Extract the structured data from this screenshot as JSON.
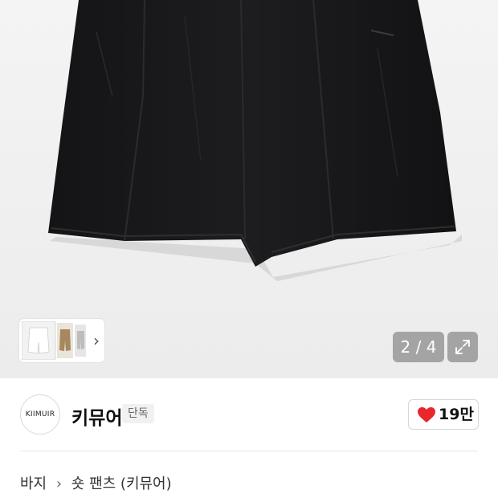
{
  "gallery": {
    "counter": "2 / 4",
    "icons": {
      "expand": "expand-icon",
      "next": "chevron-right-icon"
    }
  },
  "brand": {
    "logo_text": "KIIMUIR",
    "name": "키뮤어",
    "badge": "단독"
  },
  "like": {
    "count": "19만",
    "icon": "heart-icon",
    "color": "#e8272b"
  },
  "breadcrumb": {
    "items": [
      "바지",
      "숏 팬츠 (키뮤어)"
    ],
    "separator_icon": "chevron-right-icon"
  }
}
